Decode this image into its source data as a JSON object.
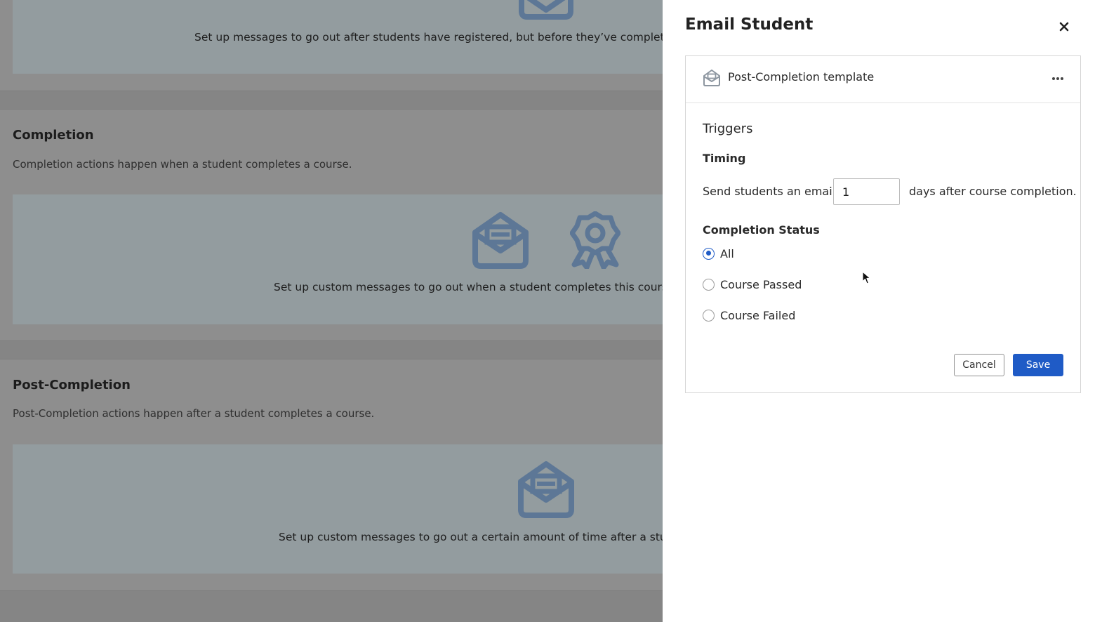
{
  "background": {
    "sections": [
      {
        "message": "Set up messages to go out after students have registered, but before they’ve completed th"
      },
      {
        "heading": "Completion",
        "description": "Completion actions happen when a student completes a course.",
        "message": "Set up custom messages to go out when a student completes this course (c"
      },
      {
        "heading": "Post-Completion",
        "description": "Post-Completion actions happen after a student completes a course.",
        "message": "Set up custom messages to go out a certain amount of time after a studer"
      }
    ],
    "icons": [
      "envelope-icon",
      "award-ribbon-icon"
    ],
    "icon_color": "#5d7796"
  },
  "panel": {
    "title": "Email Student",
    "close_icon": "close-icon",
    "template": {
      "icon": "envelope-icon",
      "name": "Post-Completion template",
      "more_icon": "more-options-icon"
    },
    "triggers_label": "Triggers",
    "timing": {
      "label": "Timing",
      "prefix": "Send students an email",
      "days_value": "1",
      "suffix": "days after course completion."
    },
    "completion_status": {
      "label": "Completion Status",
      "options": [
        {
          "label": "All",
          "checked": true
        },
        {
          "label": "Course Passed",
          "checked": false
        },
        {
          "label": "Course Failed",
          "checked": false
        }
      ]
    },
    "buttons": {
      "cancel": "Cancel",
      "save": "Save"
    },
    "accent_color": "#1f5bc6"
  }
}
